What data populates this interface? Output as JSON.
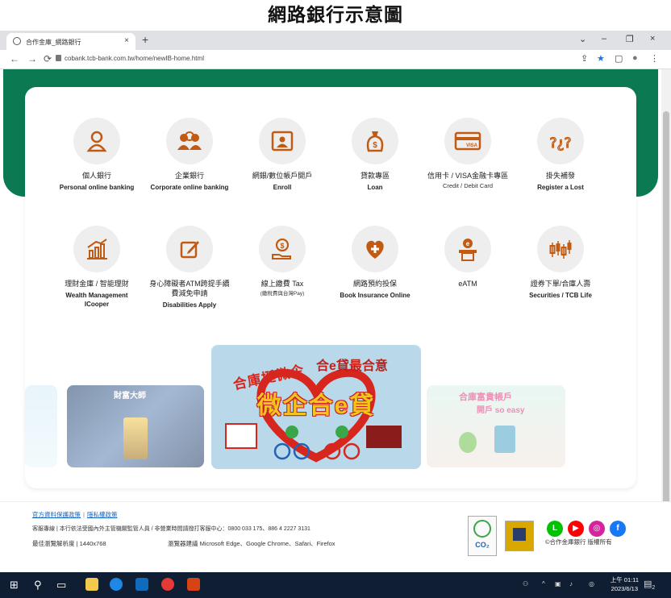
{
  "heading": "網路銀行示意圖",
  "browser": {
    "tab_title": "合作金庫_網路銀行",
    "tab_close": "×",
    "new_tab": "+",
    "url": "cobank.tcb-bank.com.tw/home/newIB-home.html",
    "win_controls": {
      "chevron": "⌄",
      "minimize": "–",
      "restore": "❐",
      "close": "×"
    },
    "nav": {
      "back": "←",
      "forward": "→",
      "reload": "⟳"
    },
    "toolbar_icons": {
      "share": "⇪",
      "star": "★",
      "sidebar": "▢",
      "profile": "●",
      "menu": "⋮"
    }
  },
  "services_row1": [
    {
      "zh": "個人銀行",
      "en": "Personal online banking",
      "icon": "person-icon"
    },
    {
      "zh": "企業銀行",
      "en": "Corporate online banking",
      "icon": "group-icon"
    },
    {
      "zh": "網銀/數位帳戶開戶",
      "en": "Enroll",
      "icon": "id-card-icon"
    },
    {
      "zh": "貸款專區",
      "en": "Loan",
      "icon": "money-bag-icon"
    },
    {
      "zh": "信用卡 / VISA金融卡專區",
      "en": "Credit / Debit Card",
      "icon": "credit-card-icon"
    },
    {
      "zh": "掛失補發",
      "en": "Register a Lost",
      "icon": "question-icon"
    }
  ],
  "services_row2": [
    {
      "zh": "理財金庫 / 智能理財",
      "en": "Wealth Management",
      "en2": "ICooper",
      "icon": "bar-chart-icon"
    },
    {
      "zh": "身心障礙者ATM跨提手續費減免申請",
      "en": "Disabilities Apply",
      "icon": "edit-icon"
    },
    {
      "zh": "線上繳費 Tax",
      "en": "(繳稅費與台灣Pay)",
      "icon": "coin-hand-icon"
    },
    {
      "zh": "網路預約投保",
      "en": "Book Insurance Online",
      "icon": "heart-plus-icon"
    },
    {
      "zh": "eATM",
      "en": "",
      "icon": "atm-icon"
    },
    {
      "zh": "證券下單/合庫人壽",
      "en": "Securities / TCB Life",
      "icon": "candlestick-icon"
    }
  ],
  "banners": {
    "b2_text": "財富大師",
    "b3_title": "合庫挺微企",
    "b3_title2": "合e貸最合意",
    "b3_big": "微企合e貸",
    "b4_title": "合庫富貴帳戶",
    "b4_sub": "開戶 so easy"
  },
  "footer": {
    "link1": "官方資料保護政策",
    "link2": "隱私權政策",
    "line2": "客服專線 | 本行依法受國內外主管機關監管人員 / 非營業時間請撥打客服中心：0800 033 175、886 4 2227 3131",
    "line3_label": "最佳瀏覽解析度 | 1440x768",
    "line3_browsers": "瀏覽器建議  Microsoft Edge、Google Chrome、Safari、Firefox",
    "copyright": "©合作金庫銀行 版權所有"
  },
  "taskbar": {
    "clock_time": "上午 01:11",
    "clock_date": "2023/6/13",
    "notif_count": "2"
  },
  "colors": {
    "brand_green": "#0b7a53",
    "icon_orange": "#c15a12",
    "line": "#00c300",
    "youtube": "#ff0000",
    "instagram": "#d6249f",
    "facebook": "#1877f2"
  }
}
